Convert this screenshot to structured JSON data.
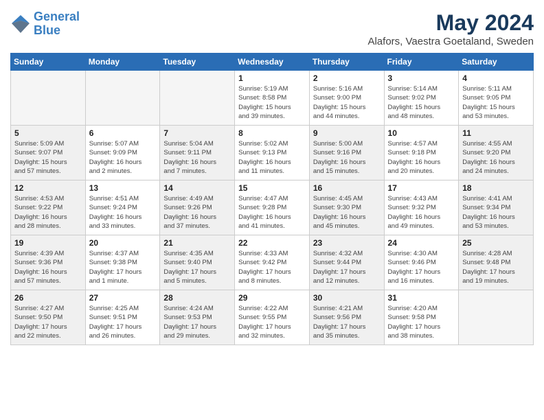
{
  "header": {
    "logo_line1": "General",
    "logo_line2": "Blue",
    "month_title": "May 2024",
    "location": "Alafors, Vaestra Goetaland, Sweden"
  },
  "days_of_week": [
    "Sunday",
    "Monday",
    "Tuesday",
    "Wednesday",
    "Thursday",
    "Friday",
    "Saturday"
  ],
  "weeks": [
    [
      {
        "day": "",
        "info": "",
        "empty": true
      },
      {
        "day": "",
        "info": "",
        "empty": true
      },
      {
        "day": "",
        "info": "",
        "empty": true
      },
      {
        "day": "1",
        "info": "Sunrise: 5:19 AM\nSunset: 8:58 PM\nDaylight: 15 hours\nand 39 minutes."
      },
      {
        "day": "2",
        "info": "Sunrise: 5:16 AM\nSunset: 9:00 PM\nDaylight: 15 hours\nand 44 minutes."
      },
      {
        "day": "3",
        "info": "Sunrise: 5:14 AM\nSunset: 9:02 PM\nDaylight: 15 hours\nand 48 minutes."
      },
      {
        "day": "4",
        "info": "Sunrise: 5:11 AM\nSunset: 9:05 PM\nDaylight: 15 hours\nand 53 minutes."
      }
    ],
    [
      {
        "day": "5",
        "info": "Sunrise: 5:09 AM\nSunset: 9:07 PM\nDaylight: 15 hours\nand 57 minutes.",
        "shaded": true
      },
      {
        "day": "6",
        "info": "Sunrise: 5:07 AM\nSunset: 9:09 PM\nDaylight: 16 hours\nand 2 minutes."
      },
      {
        "day": "7",
        "info": "Sunrise: 5:04 AM\nSunset: 9:11 PM\nDaylight: 16 hours\nand 7 minutes.",
        "shaded": true
      },
      {
        "day": "8",
        "info": "Sunrise: 5:02 AM\nSunset: 9:13 PM\nDaylight: 16 hours\nand 11 minutes."
      },
      {
        "day": "9",
        "info": "Sunrise: 5:00 AM\nSunset: 9:16 PM\nDaylight: 16 hours\nand 15 minutes.",
        "shaded": true
      },
      {
        "day": "10",
        "info": "Sunrise: 4:57 AM\nSunset: 9:18 PM\nDaylight: 16 hours\nand 20 minutes."
      },
      {
        "day": "11",
        "info": "Sunrise: 4:55 AM\nSunset: 9:20 PM\nDaylight: 16 hours\nand 24 minutes.",
        "shaded": true
      }
    ],
    [
      {
        "day": "12",
        "info": "Sunrise: 4:53 AM\nSunset: 9:22 PM\nDaylight: 16 hours\nand 28 minutes.",
        "shaded": true
      },
      {
        "day": "13",
        "info": "Sunrise: 4:51 AM\nSunset: 9:24 PM\nDaylight: 16 hours\nand 33 minutes."
      },
      {
        "day": "14",
        "info": "Sunrise: 4:49 AM\nSunset: 9:26 PM\nDaylight: 16 hours\nand 37 minutes.",
        "shaded": true
      },
      {
        "day": "15",
        "info": "Sunrise: 4:47 AM\nSunset: 9:28 PM\nDaylight: 16 hours\nand 41 minutes."
      },
      {
        "day": "16",
        "info": "Sunrise: 4:45 AM\nSunset: 9:30 PM\nDaylight: 16 hours\nand 45 minutes.",
        "shaded": true
      },
      {
        "day": "17",
        "info": "Sunrise: 4:43 AM\nSunset: 9:32 PM\nDaylight: 16 hours\nand 49 minutes."
      },
      {
        "day": "18",
        "info": "Sunrise: 4:41 AM\nSunset: 9:34 PM\nDaylight: 16 hours\nand 53 minutes.",
        "shaded": true
      }
    ],
    [
      {
        "day": "19",
        "info": "Sunrise: 4:39 AM\nSunset: 9:36 PM\nDaylight: 16 hours\nand 57 minutes.",
        "shaded": true
      },
      {
        "day": "20",
        "info": "Sunrise: 4:37 AM\nSunset: 9:38 PM\nDaylight: 17 hours\nand 1 minute."
      },
      {
        "day": "21",
        "info": "Sunrise: 4:35 AM\nSunset: 9:40 PM\nDaylight: 17 hours\nand 5 minutes.",
        "shaded": true
      },
      {
        "day": "22",
        "info": "Sunrise: 4:33 AM\nSunset: 9:42 PM\nDaylight: 17 hours\nand 8 minutes."
      },
      {
        "day": "23",
        "info": "Sunrise: 4:32 AM\nSunset: 9:44 PM\nDaylight: 17 hours\nand 12 minutes.",
        "shaded": true
      },
      {
        "day": "24",
        "info": "Sunrise: 4:30 AM\nSunset: 9:46 PM\nDaylight: 17 hours\nand 16 minutes."
      },
      {
        "day": "25",
        "info": "Sunrise: 4:28 AM\nSunset: 9:48 PM\nDaylight: 17 hours\nand 19 minutes.",
        "shaded": true
      }
    ],
    [
      {
        "day": "26",
        "info": "Sunrise: 4:27 AM\nSunset: 9:50 PM\nDaylight: 17 hours\nand 22 minutes.",
        "shaded": true
      },
      {
        "day": "27",
        "info": "Sunrise: 4:25 AM\nSunset: 9:51 PM\nDaylight: 17 hours\nand 26 minutes."
      },
      {
        "day": "28",
        "info": "Sunrise: 4:24 AM\nSunset: 9:53 PM\nDaylight: 17 hours\nand 29 minutes.",
        "shaded": true
      },
      {
        "day": "29",
        "info": "Sunrise: 4:22 AM\nSunset: 9:55 PM\nDaylight: 17 hours\nand 32 minutes."
      },
      {
        "day": "30",
        "info": "Sunrise: 4:21 AM\nSunset: 9:56 PM\nDaylight: 17 hours\nand 35 minutes.",
        "shaded": true
      },
      {
        "day": "31",
        "info": "Sunrise: 4:20 AM\nSunset: 9:58 PM\nDaylight: 17 hours\nand 38 minutes."
      },
      {
        "day": "",
        "info": "",
        "empty": true
      }
    ]
  ]
}
